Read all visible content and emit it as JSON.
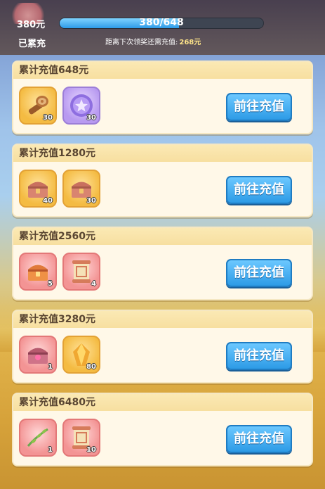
{
  "header": {
    "amount": "380元",
    "total_label": "已累充",
    "progress_text": "380/648",
    "progress_fraction": 0.586,
    "next_tip_label": "距离下次领奖还需充值:",
    "next_tip_value": "268元"
  },
  "tiers": [
    {
      "title": "累计充值648元",
      "button": "前往充值",
      "rewards": [
        {
          "icon": "wood-stump-icon",
          "count": "30",
          "frame": "gold"
        },
        {
          "icon": "purple-coin-icon",
          "count": "30",
          "frame": "purple"
        }
      ]
    },
    {
      "title": "累计充值1280元",
      "button": "前往充值",
      "rewards": [
        {
          "icon": "treasure-chest-icon",
          "count": "40",
          "frame": "gold"
        },
        {
          "icon": "treasure-chest-icon",
          "count": "30",
          "frame": "gold"
        }
      ]
    },
    {
      "title": "累计充值2560元",
      "button": "前往充值",
      "rewards": [
        {
          "icon": "red-chest-icon",
          "count": "5",
          "frame": "red"
        },
        {
          "icon": "scroll-icon",
          "count": "4",
          "frame": "red"
        }
      ]
    },
    {
      "title": "累计充值3280元",
      "button": "前往充值",
      "rewards": [
        {
          "icon": "jeweled-chest-icon",
          "count": "1",
          "frame": "red"
        },
        {
          "icon": "gold-crystal-icon",
          "count": "80",
          "frame": "gold"
        }
      ]
    },
    {
      "title": "累计充值6480元",
      "button": "前往充值",
      "rewards": [
        {
          "icon": "green-vine-icon",
          "count": "1",
          "frame": "red"
        },
        {
          "icon": "scroll-icon",
          "count": "10",
          "frame": "red"
        }
      ]
    }
  ]
}
